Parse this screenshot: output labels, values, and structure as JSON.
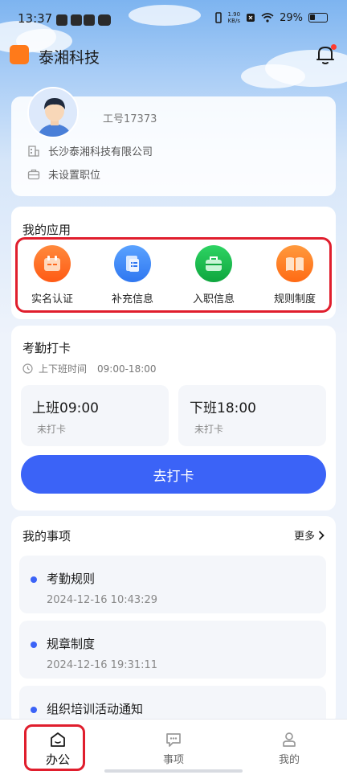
{
  "status_bar": {
    "time": "13:37",
    "net_speed_value": "1.90",
    "net_speed_unit": "KB/s",
    "battery": "29%"
  },
  "header": {
    "company_title": "泰湘科技",
    "logo_color": "#ff7a1a"
  },
  "profile": {
    "employee_no": "工号17373",
    "company": "长沙泰湘科技有限公司",
    "position": "未设置职位"
  },
  "apps": {
    "title": "我的应用",
    "items": [
      {
        "label": "实名认证",
        "icon": "id-card-icon",
        "color": "#ff6a1f"
      },
      {
        "label": "补充信息",
        "icon": "document-icon",
        "color": "#3d8af7"
      },
      {
        "label": "入职信息",
        "icon": "briefcase-icon",
        "color": "#12b84a"
      },
      {
        "label": "规则制度",
        "icon": "book-icon",
        "color": "#ff7a1a"
      }
    ]
  },
  "attendance": {
    "title": "考勤打卡",
    "hours_label": "上下班时间",
    "hours_value": "09:00-18:00",
    "clock_in": {
      "time": "上班09:00",
      "status": "未打卡"
    },
    "clock_out": {
      "time": "下班18:00",
      "status": "未打卡"
    },
    "punch_button": "去打卡",
    "accent_color": "#3b63f7"
  },
  "matters": {
    "title": "我的事项",
    "more": "更多",
    "items": [
      {
        "title": "考勤规则",
        "date": "2024-12-16 10:43:29"
      },
      {
        "title": "规章制度",
        "date": "2024-12-16 19:31:11"
      },
      {
        "title": "组织培训活动通知",
        "date": ""
      }
    ]
  },
  "tabbar": {
    "items": [
      {
        "label": "办公",
        "icon": "home-icon",
        "active": true
      },
      {
        "label": "事项",
        "icon": "chat-icon",
        "active": false
      },
      {
        "label": "我的",
        "icon": "profile-icon",
        "active": false
      }
    ]
  },
  "highlight_color": "#e01e2d"
}
